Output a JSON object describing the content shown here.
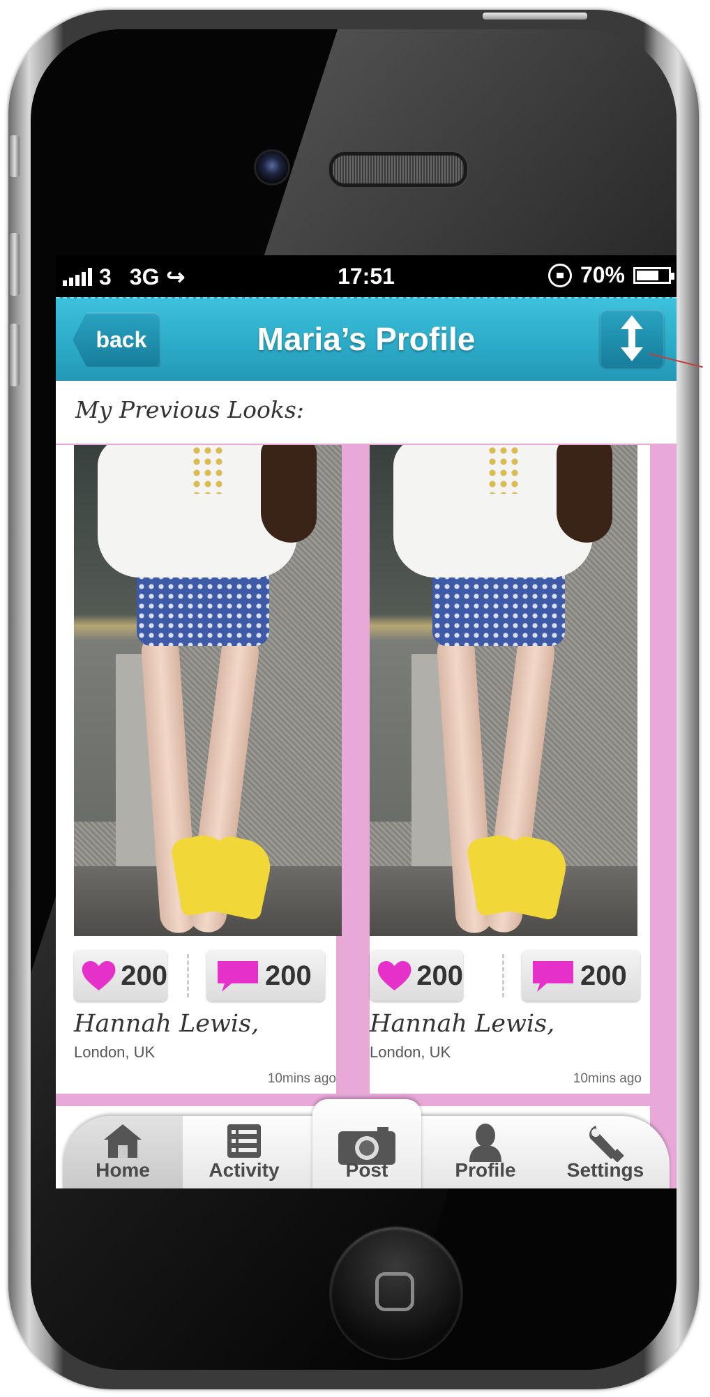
{
  "status_bar": {
    "carrier": "3",
    "network": "3G",
    "time": "17:51",
    "battery": "70%",
    "battery_level": 0.7
  },
  "nav": {
    "back_label": "back",
    "title": "Maria’s Profile",
    "sort_icon": "up-down-arrow-icon"
  },
  "section": {
    "title": "My Previous Looks:"
  },
  "looks": [
    {
      "likes": "200",
      "comments": "200",
      "author": "Hannah Lewis,",
      "location": "London, UK",
      "time": "10mins ago"
    },
    {
      "likes": "200",
      "comments": "200",
      "author": "Hannah Lewis,",
      "location": "London, UK",
      "time": "10mins ago"
    }
  ],
  "tabbar": {
    "items": [
      {
        "label": "Home",
        "icon": "house-icon"
      },
      {
        "label": "Activity",
        "icon": "list-icon"
      },
      {
        "label": "Post",
        "icon": "camera-icon"
      },
      {
        "label": "Profile",
        "icon": "person-icon"
      },
      {
        "label": "Settings",
        "icon": "wrench-icon"
      }
    ]
  },
  "colors": {
    "nav_blue": "#2ba9c6",
    "like_pink": "#e531c9",
    "background_pink": "#e8a8d8"
  }
}
